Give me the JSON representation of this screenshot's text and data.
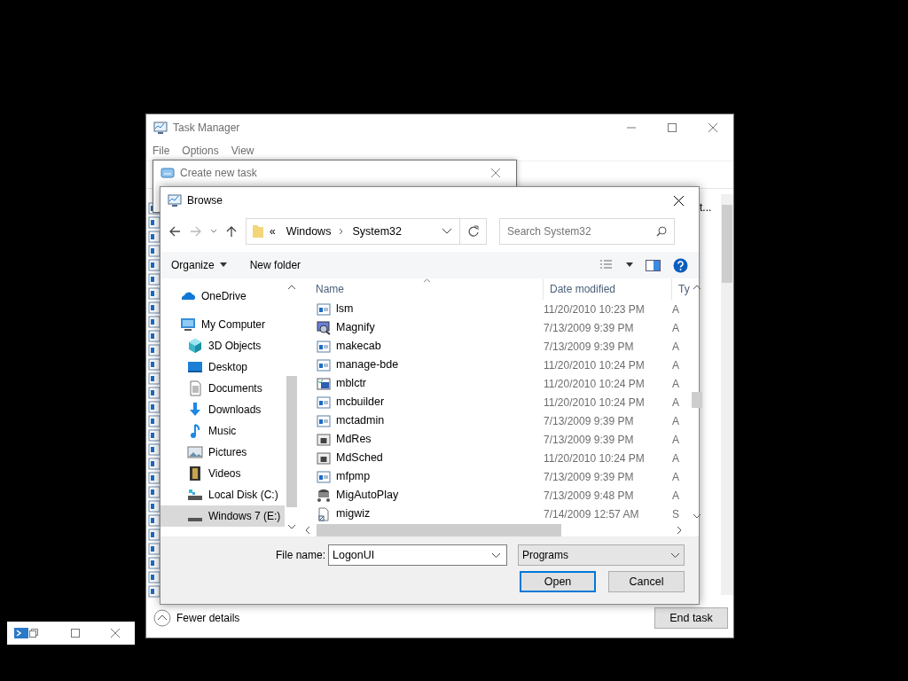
{
  "task_manager": {
    "title": "Task Manager",
    "menu": [
      "File",
      "Options",
      "View"
    ],
    "column_fragment": "t...",
    "fewer_details": "Fewer details",
    "end_task": "End task"
  },
  "create_new_task": {
    "title": "Create new task"
  },
  "browse": {
    "title": "Browse",
    "address": {
      "overflow": "«",
      "segments": [
        "Windows",
        "System32"
      ]
    },
    "search": {
      "placeholder": "Search System32"
    },
    "toolbar": [
      "Organize",
      "New folder"
    ],
    "nav": [
      {
        "label": "OneDrive",
        "kind": "cloud",
        "selected": false
      },
      {
        "label": "My Computer",
        "kind": "computer",
        "selected": false,
        "children": [
          {
            "label": "3D Objects",
            "kind": "cube",
            "selected": false
          },
          {
            "label": "Desktop",
            "kind": "desktop",
            "selected": false
          },
          {
            "label": "Documents",
            "kind": "document",
            "selected": false
          },
          {
            "label": "Downloads",
            "kind": "download",
            "selected": false
          },
          {
            "label": "Music",
            "kind": "music",
            "selected": false
          },
          {
            "label": "Pictures",
            "kind": "picture",
            "selected": false
          },
          {
            "label": "Videos",
            "kind": "video",
            "selected": false
          },
          {
            "label": "Local Disk (C:)",
            "kind": "disk",
            "selected": false
          },
          {
            "label": "Windows 7 (E:)",
            "kind": "drive",
            "selected": true
          }
        ]
      }
    ],
    "columns": [
      "Name",
      "Date modified",
      "Ty"
    ],
    "rows": [
      {
        "name": "lsm",
        "date": "11/20/2010 10:23 PM",
        "type": "A",
        "kind": "app"
      },
      {
        "name": "Magnify",
        "date": "7/13/2009 9:39 PM",
        "type": "A",
        "kind": "magnify"
      },
      {
        "name": "makecab",
        "date": "7/13/2009 9:39 PM",
        "type": "A",
        "kind": "app"
      },
      {
        "name": "manage-bde",
        "date": "11/20/2010 10:24 PM",
        "type": "A",
        "kind": "app"
      },
      {
        "name": "mblctr",
        "date": "11/20/2010 10:24 PM",
        "type": "A",
        "kind": "mobility"
      },
      {
        "name": "mcbuilder",
        "date": "11/20/2010 10:24 PM",
        "type": "A",
        "kind": "app"
      },
      {
        "name": "mctadmin",
        "date": "7/13/2009 9:39 PM",
        "type": "A",
        "kind": "app"
      },
      {
        "name": "MdRes",
        "date": "7/13/2009 9:39 PM",
        "type": "A",
        "kind": "chip"
      },
      {
        "name": "MdSched",
        "date": "11/20/2010 10:24 PM",
        "type": "A",
        "kind": "chip"
      },
      {
        "name": "mfpmp",
        "date": "7/13/2009 9:39 PM",
        "type": "A",
        "kind": "app"
      },
      {
        "name": "MigAutoPlay",
        "date": "7/13/2009 9:48 PM",
        "type": "A",
        "kind": "migrate"
      },
      {
        "name": "migwiz",
        "date": "7/14/2009 12:57 AM",
        "type": "S",
        "kind": "shortcut"
      }
    ],
    "file_name": {
      "label": "File name:",
      "value": "LogonUI"
    },
    "filter": "Programs",
    "buttons": [
      {
        "label": "Open",
        "default": true
      },
      {
        "label": "Cancel",
        "default": false
      }
    ]
  }
}
